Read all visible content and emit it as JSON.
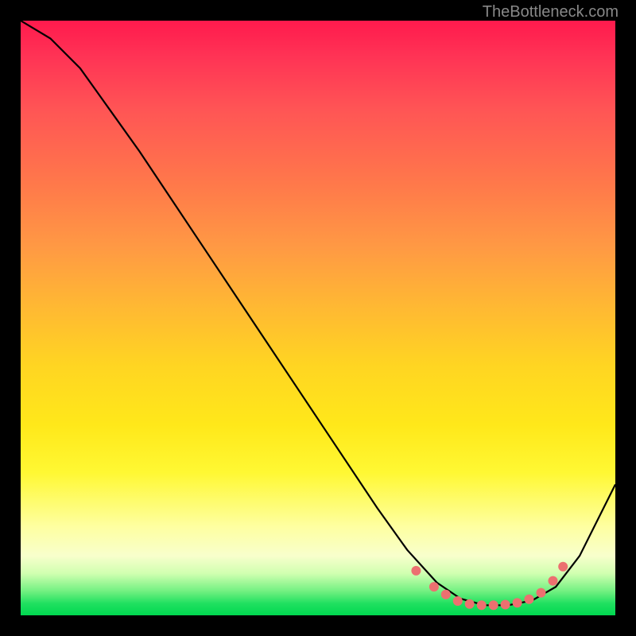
{
  "watermark": "TheBottleneck.com",
  "chart_data": {
    "type": "line",
    "title": "",
    "xlabel": "",
    "ylabel": "",
    "xlim": [
      0,
      1
    ],
    "ylim": [
      0,
      1
    ],
    "series": [
      {
        "name": "curve",
        "color": "#000000",
        "x": [
          0.0,
          0.05,
          0.1,
          0.15,
          0.2,
          0.3,
          0.4,
          0.5,
          0.6,
          0.65,
          0.7,
          0.74,
          0.78,
          0.82,
          0.86,
          0.9,
          0.94,
          1.0
        ],
        "y": [
          1.0,
          0.97,
          0.92,
          0.85,
          0.78,
          0.63,
          0.48,
          0.33,
          0.18,
          0.11,
          0.055,
          0.028,
          0.017,
          0.017,
          0.025,
          0.048,
          0.1,
          0.22
        ]
      }
    ],
    "points": {
      "name": "highlighted-dots",
      "color": "#ec7070",
      "x": [
        0.665,
        0.695,
        0.715,
        0.735,
        0.755,
        0.775,
        0.795,
        0.815,
        0.835,
        0.855,
        0.875,
        0.895,
        0.912
      ],
      "y": [
        0.075,
        0.048,
        0.035,
        0.024,
        0.019,
        0.017,
        0.017,
        0.018,
        0.021,
        0.027,
        0.038,
        0.058,
        0.082
      ]
    }
  }
}
